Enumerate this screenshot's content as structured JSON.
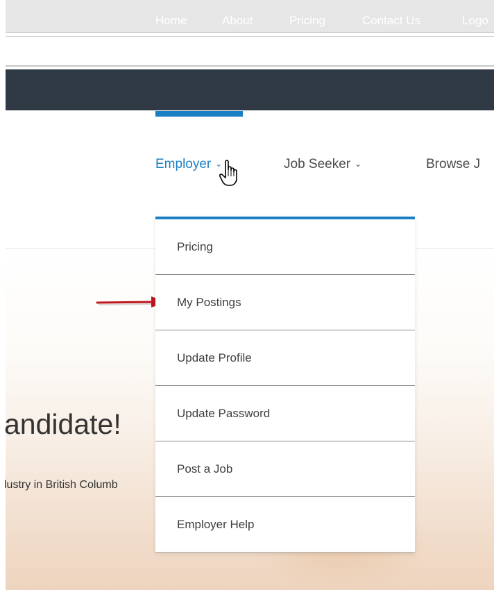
{
  "top_nav": {
    "items": [
      "Home",
      "About",
      "Pricing",
      "Contact Us",
      "Logo"
    ]
  },
  "sub_nav": {
    "employer": "Employer",
    "job_seeker": "Job Seeker",
    "browse": "Browse J",
    "caret": "⌄"
  },
  "dropdown": {
    "items": [
      "Pricing",
      "My Postings",
      "Update Profile",
      "Update Password",
      "Post a Job",
      "Employer Help"
    ]
  },
  "hero": {
    "title": "andidate!",
    "subtitle": "lustry in British Columb"
  },
  "colors": {
    "nav_bg": "#2f3a45",
    "accent": "#1a7fc5",
    "arrow": "#c0171c"
  },
  "icons": {
    "cursor": "hand-pointer-icon",
    "arrow": "arrow-right-icon"
  }
}
